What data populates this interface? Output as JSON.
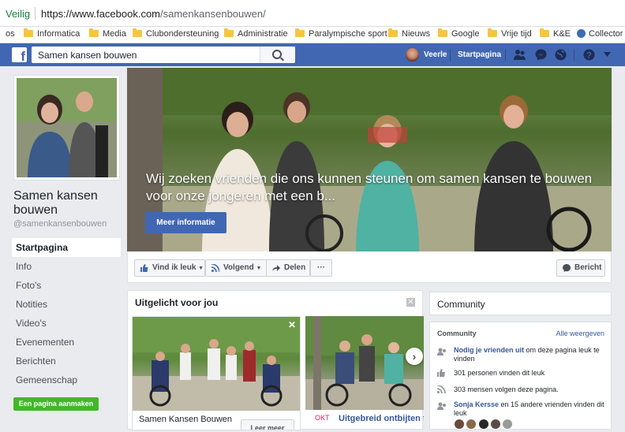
{
  "browser": {
    "secure_label": "Veilig",
    "url_host": "https://www.facebook.com",
    "url_path": "/samenkansenbouwen/",
    "bookmarks": [
      {
        "label": "os",
        "type": "text"
      },
      {
        "label": "Informatica",
        "type": "folder"
      },
      {
        "label": "Media",
        "type": "folder"
      },
      {
        "label": "Clubondersteuning",
        "type": "folder"
      },
      {
        "label": "Administratie",
        "type": "folder"
      },
      {
        "label": "Paralympische sport",
        "type": "folder"
      },
      {
        "label": "Nieuws",
        "type": "folder"
      },
      {
        "label": "Google",
        "type": "folder"
      },
      {
        "label": "Vrije tijd",
        "type": "folder"
      },
      {
        "label": "K&E",
        "type": "folder"
      },
      {
        "label": "Collector",
        "type": "icon"
      }
    ]
  },
  "fbbar": {
    "logo": "f",
    "search_value": "Samen kansen bouwen",
    "user_name": "Veerle",
    "home_label": "Startpagina",
    "colors": {
      "bar": "#4267b2"
    }
  },
  "page": {
    "name": "Samen kansen bouwen",
    "handle": "@samenkansenbouwen",
    "nav": [
      {
        "label": "Startpagina",
        "active": true
      },
      {
        "label": "Info",
        "active": false
      },
      {
        "label": "Foto's",
        "active": false
      },
      {
        "label": "Notities",
        "active": false
      },
      {
        "label": "Video's",
        "active": false
      },
      {
        "label": "Evenementen",
        "active": false
      },
      {
        "label": "Berichten",
        "active": false
      },
      {
        "label": "Gemeenschap",
        "active": false
      }
    ],
    "create_button": "Een pagina aanmaken"
  },
  "cover": {
    "caption_line1": "Wij zoeken vrienden die ons kunnen steunen om samen kansen te bouwen",
    "caption_line2": "voor onze jongeren met een b...",
    "button": "Meer informatie"
  },
  "actions": {
    "like": "Vind ik leuk",
    "follow": "Volgend",
    "share": "Delen",
    "more": "···",
    "message": "Bericht"
  },
  "featured": {
    "title": "Uitgelicht voor jou",
    "card1": {
      "title": "Samen Kansen Bouwen",
      "button": "Leer meer"
    },
    "card2": {
      "month": "OKT",
      "title": "Uitgebreid ontbijten t"
    }
  },
  "community": {
    "header": "Community",
    "sub_title": "Community",
    "see_all": "Alle weergeven",
    "invite_link": "Nodig je vrienden uit",
    "invite_text": " om deze pagina leuk te vinden",
    "likes": "301 personen vinden dit leuk",
    "follows": "303 mensen volgen deze pagina.",
    "friend_name": "Sonja Kersse",
    "friend_text": " en 15 andere vrienden vinden dit leuk"
  }
}
